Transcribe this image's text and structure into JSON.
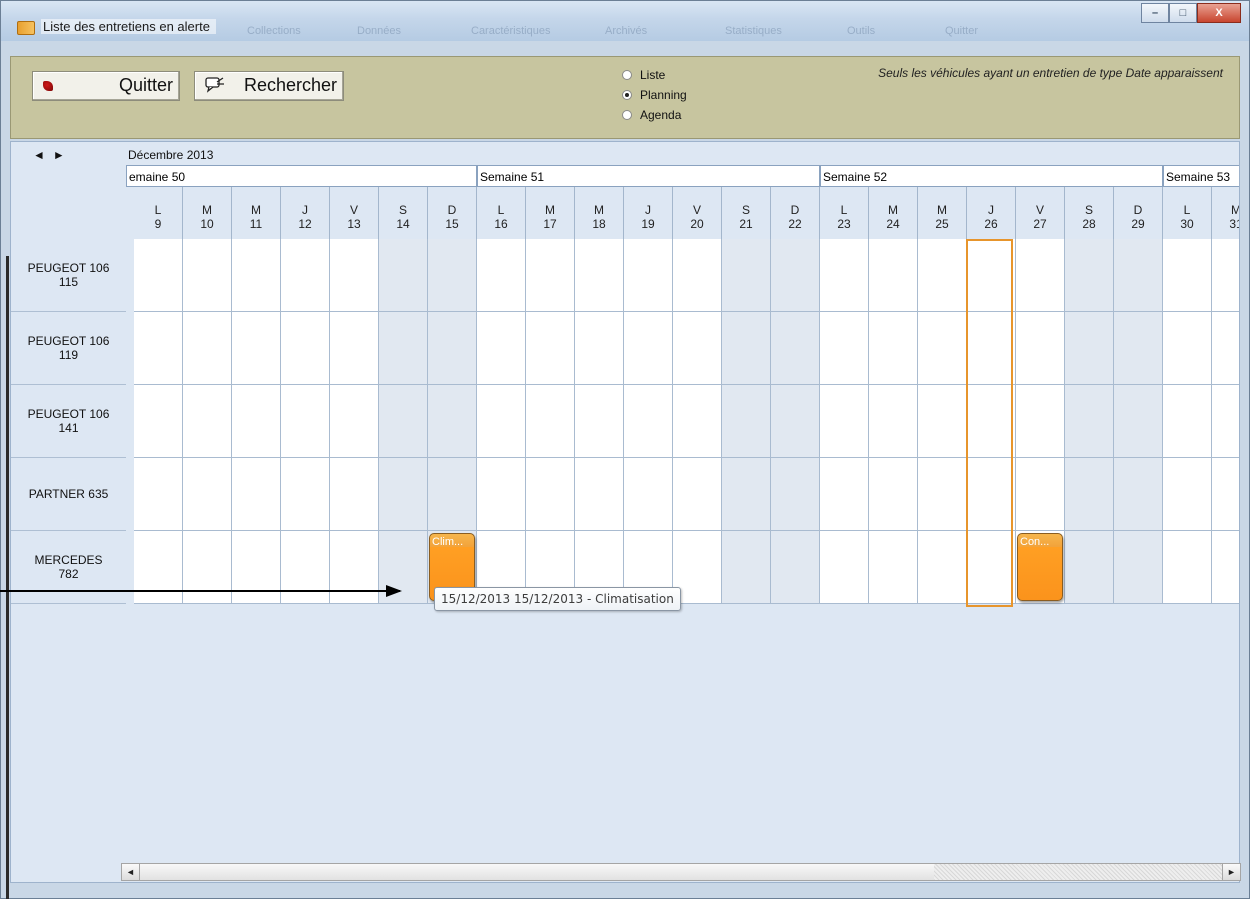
{
  "window": {
    "title": "Liste des entretiens en alerte",
    "background_menu": [
      "Collections",
      "Données",
      "Caractéristiques",
      "Archivés",
      "Statistiques",
      "Outils",
      "Quitter"
    ],
    "controls": {
      "minimize": "–",
      "maximize": "□",
      "close": "X"
    }
  },
  "toolbar": {
    "quit_label": "Quitter",
    "search_label": "Rechercher",
    "view_options": [
      {
        "label": "Liste",
        "checked": false
      },
      {
        "label": "Planning",
        "checked": true
      },
      {
        "label": "Agenda",
        "checked": false
      }
    ],
    "note": "Seuls les véhicules ayant un entretien de type Date apparaissent"
  },
  "planner": {
    "nav_prev": "◄",
    "nav_next": "►",
    "month": "Décembre 2013",
    "weeks": [
      "emaine 50",
      "Semaine 51",
      "Semaine 52",
      "Semaine 53"
    ],
    "days": [
      {
        "letter": "L",
        "num": "9",
        "weekend": false
      },
      {
        "letter": "M",
        "num": "10",
        "weekend": false
      },
      {
        "letter": "M",
        "num": "11",
        "weekend": false
      },
      {
        "letter": "J",
        "num": "12",
        "weekend": false
      },
      {
        "letter": "V",
        "num": "13",
        "weekend": false
      },
      {
        "letter": "S",
        "num": "14",
        "weekend": true
      },
      {
        "letter": "D",
        "num": "15",
        "weekend": true
      },
      {
        "letter": "L",
        "num": "16",
        "weekend": false
      },
      {
        "letter": "M",
        "num": "17",
        "weekend": false
      },
      {
        "letter": "M",
        "num": "18",
        "weekend": false
      },
      {
        "letter": "J",
        "num": "19",
        "weekend": false
      },
      {
        "letter": "V",
        "num": "20",
        "weekend": false
      },
      {
        "letter": "S",
        "num": "21",
        "weekend": true
      },
      {
        "letter": "D",
        "num": "22",
        "weekend": true
      },
      {
        "letter": "L",
        "num": "23",
        "weekend": false
      },
      {
        "letter": "M",
        "num": "24",
        "weekend": false
      },
      {
        "letter": "M",
        "num": "25",
        "weekend": false
      },
      {
        "letter": "J",
        "num": "26",
        "weekend": false
      },
      {
        "letter": "V",
        "num": "27",
        "weekend": false
      },
      {
        "letter": "S",
        "num": "28",
        "weekend": true
      },
      {
        "letter": "D",
        "num": "29",
        "weekend": true
      },
      {
        "letter": "L",
        "num": "30",
        "weekend": false
      },
      {
        "letter": "M",
        "num": "31",
        "weekend": false
      }
    ],
    "vehicles": [
      "PEUGEOT 106\n115",
      "PEUGEOT 106\n119",
      "PEUGEOT 106\n141",
      "PARTNER 635",
      "MERCEDES\n782"
    ],
    "today": "26",
    "events": [
      {
        "vehicle": "MERCEDES\n782",
        "day": "15",
        "label": "Clim..."
      },
      {
        "vehicle": "MERCEDES\n782",
        "day": "27",
        "label": "Con..."
      }
    ],
    "tooltip": "15/12/2013 15/12/2013 - Climatisation"
  },
  "scrollbar": {
    "left": "◄",
    "right": "►"
  },
  "colors": {
    "event": "#fb931c",
    "today": "#e7952c",
    "toolbar": "#c7c59f",
    "planner": "#dde7f3"
  }
}
